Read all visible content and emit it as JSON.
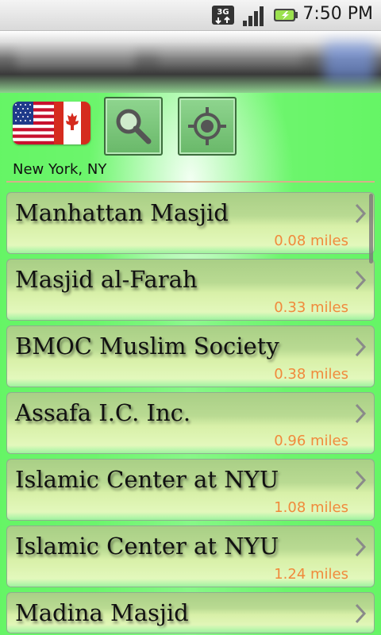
{
  "status_bar": {
    "network_type": "3G",
    "time": "7:50 PM",
    "icons": [
      "3g-data-icon",
      "signal-strength-icon",
      "battery-charging-icon"
    ]
  },
  "toolbar": {
    "flag_icon": "usa-canada-flag-icon",
    "search_icon": "magnifier-icon",
    "locate_icon": "crosshair-target-icon"
  },
  "location": {
    "label": "New York, NY"
  },
  "colors": {
    "accent_green": "#66f566",
    "distance_text": "#f08a3c"
  },
  "results": [
    {
      "name": "Manhattan Masjid",
      "distance": "0.08 miles"
    },
    {
      "name": "Masjid al-Farah",
      "distance": "0.33 miles"
    },
    {
      "name": "BMOC Muslim Society",
      "distance": "0.38 miles"
    },
    {
      "name": "Assafa I.C. Inc.",
      "distance": "0.96 miles"
    },
    {
      "name": "Islamic Center at NYU",
      "distance": "1.08 miles"
    },
    {
      "name": "Islamic Center at NYU",
      "distance": "1.24 miles"
    },
    {
      "name": "Madina Masjid",
      "distance": ""
    }
  ]
}
